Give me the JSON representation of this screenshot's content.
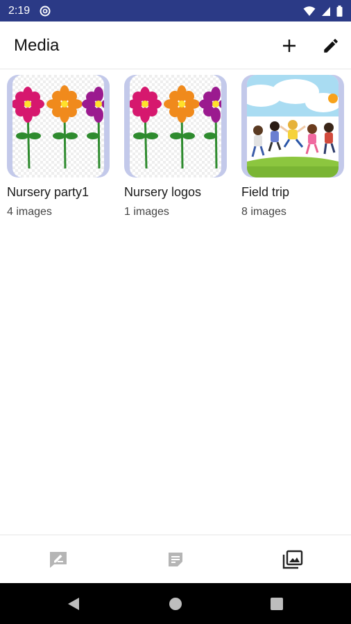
{
  "status_bar": {
    "time": "2:19",
    "icons": [
      "at-sign-notification-icon",
      "wifi-icon",
      "cell-signal-icon",
      "battery-icon"
    ],
    "background": "#2b3a86"
  },
  "app_bar": {
    "title": "Media",
    "actions": [
      {
        "name": "add-button",
        "icon": "plus-icon"
      },
      {
        "name": "edit-button",
        "icon": "pencil-icon"
      }
    ]
  },
  "albums": [
    {
      "name": "Nursery party1",
      "count": "4 images",
      "thumbnail": "flowers-illustration"
    },
    {
      "name": "Nursery logos",
      "count": "1 images",
      "thumbnail": "flowers-illustration"
    },
    {
      "name": "Field trip",
      "count": "8 images",
      "thumbnail": "kids-jumping-illustration"
    }
  ],
  "bottom_nav": {
    "items": [
      {
        "name": "nav-compose",
        "icon": "compose-icon",
        "active": false
      },
      {
        "name": "nav-notes",
        "icon": "note-icon",
        "active": false
      },
      {
        "name": "nav-media",
        "icon": "photo-library-icon",
        "active": true
      }
    ]
  },
  "colors": {
    "accent": "#2b3a86",
    "thumb_frame": "#c3c9ea",
    "inactive_icon": "#b5b5b5",
    "active_icon": "#222222"
  },
  "system_nav": {
    "buttons": [
      "back-icon",
      "home-icon",
      "recents-icon"
    ]
  }
}
